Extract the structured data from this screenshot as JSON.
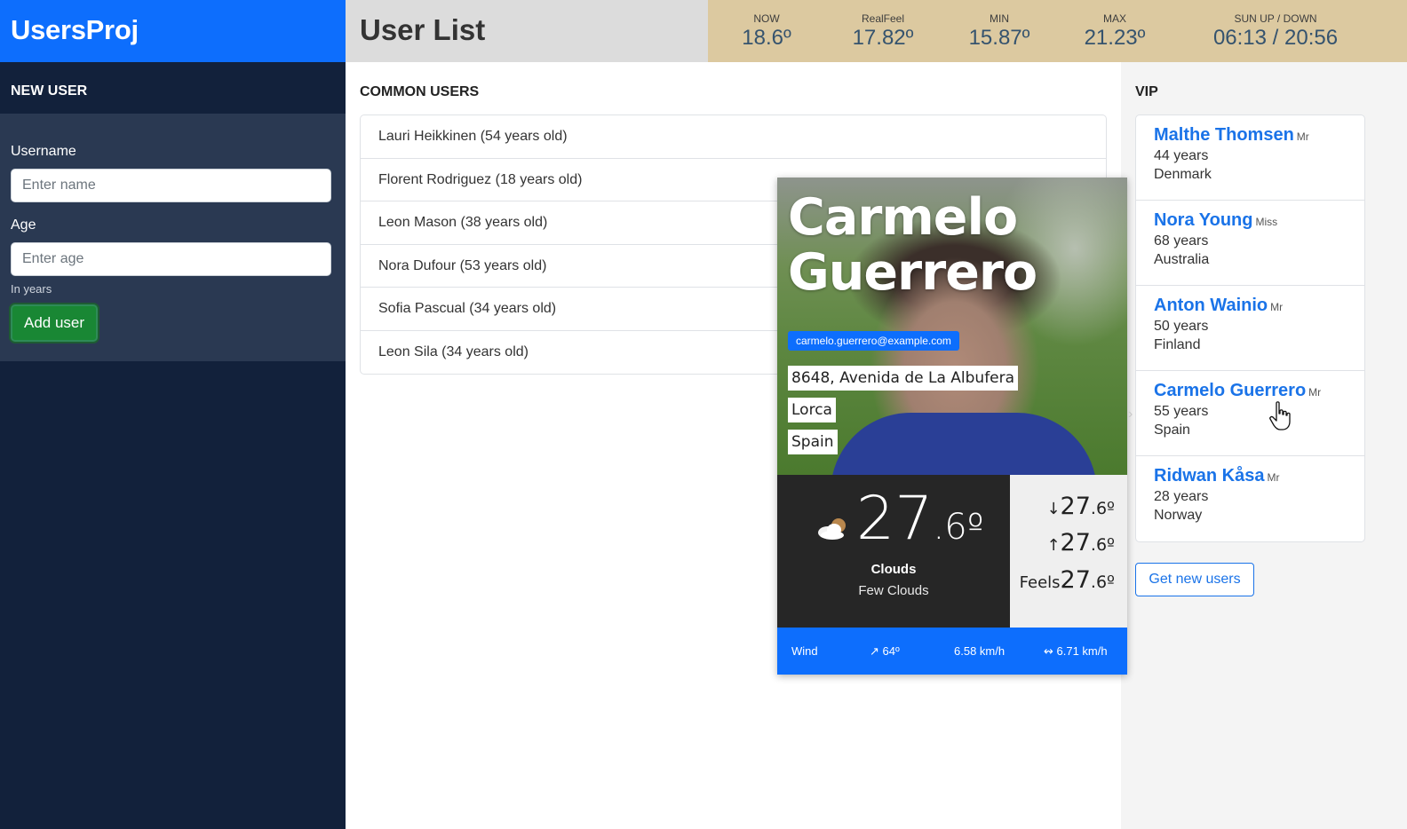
{
  "app": {
    "brand": "UsersProj"
  },
  "header": {
    "title": "User List"
  },
  "weather_bar": {
    "now": {
      "label": "NOW",
      "value": "18.6º"
    },
    "realfeel": {
      "label": "RealFeel",
      "value": "17.82º"
    },
    "min": {
      "label": "MIN",
      "value": "15.87º"
    },
    "max": {
      "label": "MAX",
      "value": "21.23º"
    },
    "sun": {
      "label": "SUN UP / DOWN",
      "value": "06:13 / 20:56"
    }
  },
  "new_user": {
    "heading": "NEW USER",
    "username_label": "Username",
    "username_placeholder": "Enter name",
    "age_label": "Age",
    "age_placeholder": "Enter age",
    "age_help": "In years",
    "submit_label": "Add user"
  },
  "common_users": {
    "heading": "COMMON USERS",
    "items": [
      "Lauri Heikkinen (54 years old)",
      "Florent Rodriguez (18 years old)",
      "Leon Mason (38 years old)",
      "Nora Dufour (53 years old)",
      "Sofia Pascual (34 years old)",
      "Leon Sila (34 years old)"
    ]
  },
  "vip": {
    "heading": "VIP",
    "items": [
      {
        "name": "Malthe Thomsen",
        "title": "Mr",
        "age": "44 years",
        "country": "Denmark"
      },
      {
        "name": "Nora Young",
        "title": "Miss",
        "age": "68 years",
        "country": "Australia"
      },
      {
        "name": "Anton Wainio",
        "title": "Mr",
        "age": "50 years",
        "country": "Finland"
      },
      {
        "name": "Carmelo Guerrero",
        "title": "Mr",
        "age": "55 years",
        "country": "Spain"
      },
      {
        "name": "Ridwan Kåsa",
        "title": "Mr",
        "age": "28 years",
        "country": "Norway"
      }
    ],
    "button_label": "Get new users"
  },
  "popup": {
    "first_name": "Carmelo",
    "last_name": "Guerrero",
    "email": "carmelo.guerrero@example.com",
    "address_street": "8648, Avenida de La Albufera",
    "address_city": "Lorca",
    "address_country": "Spain",
    "weather": {
      "temp_int": "27",
      "temp_dec": ".6º",
      "condition": "Clouds",
      "description": "Few Clouds",
      "icon": "few-clouds-icon",
      "min_arrow": "↓",
      "min_int": "27",
      "min_dec": ".6º",
      "max_arrow": "↑",
      "max_int": "27",
      "max_dec": ".6º",
      "feels_label": "Feels",
      "feels_int": "27",
      "feels_dec": ".6º"
    },
    "wind": {
      "label": "Wind",
      "direction": "↗ 64º",
      "speed": "6.58 km/h",
      "gust": "↭ 6.71 km/h"
    }
  },
  "colors": {
    "brand": "#0d6efd",
    "sidebar": "#12213b",
    "weather_bar": "#dcc9a0",
    "add_button": "#198734",
    "vip_link": "#1a73e8"
  }
}
